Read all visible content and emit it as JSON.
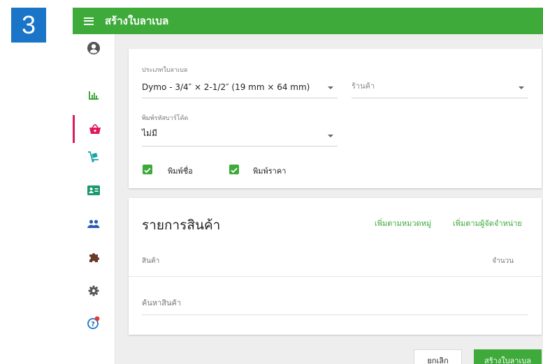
{
  "step_number": "3",
  "topbar": {
    "title": "สร้างใบลาเบล"
  },
  "sidebar": {
    "items": [
      "account-icon",
      "reports-icon",
      "shop-icon",
      "delivery-icon",
      "contact-card-icon",
      "users-icon",
      "puzzle-icon",
      "settings-icon",
      "help-icon"
    ]
  },
  "form": {
    "label_type_label": "ประเภทใบลาเบล",
    "label_type_value": "Dymo - 3/4″ × 2-1/2″ (19 mm × 64 mm)",
    "store_placeholder": "ร้านค้า",
    "barcode_label": "พิมพ์รหัสบาร์โค้ด",
    "barcode_value": "ไม่มี",
    "print_name_label": "พิมพ์ชื่อ",
    "print_price_label": "พิมพ์ราคา"
  },
  "products": {
    "title": "รายการสินค้า",
    "add_by_category": "เพิ่มตามหมวดหมู่",
    "add_by_supplier": "เพิ่มตามผู้จัดจำหน่าย",
    "col_product": "สินค้า",
    "col_quantity": "จำนวน",
    "search_placeholder": "ค้นหาสินค้า"
  },
  "actions": {
    "cancel": "ยกเลิก",
    "create": "สร้างใบลาเบล"
  },
  "colors": {
    "primary": "#3daa3a",
    "badge": "#1a74c8",
    "active_indicator": "#e0195a"
  }
}
